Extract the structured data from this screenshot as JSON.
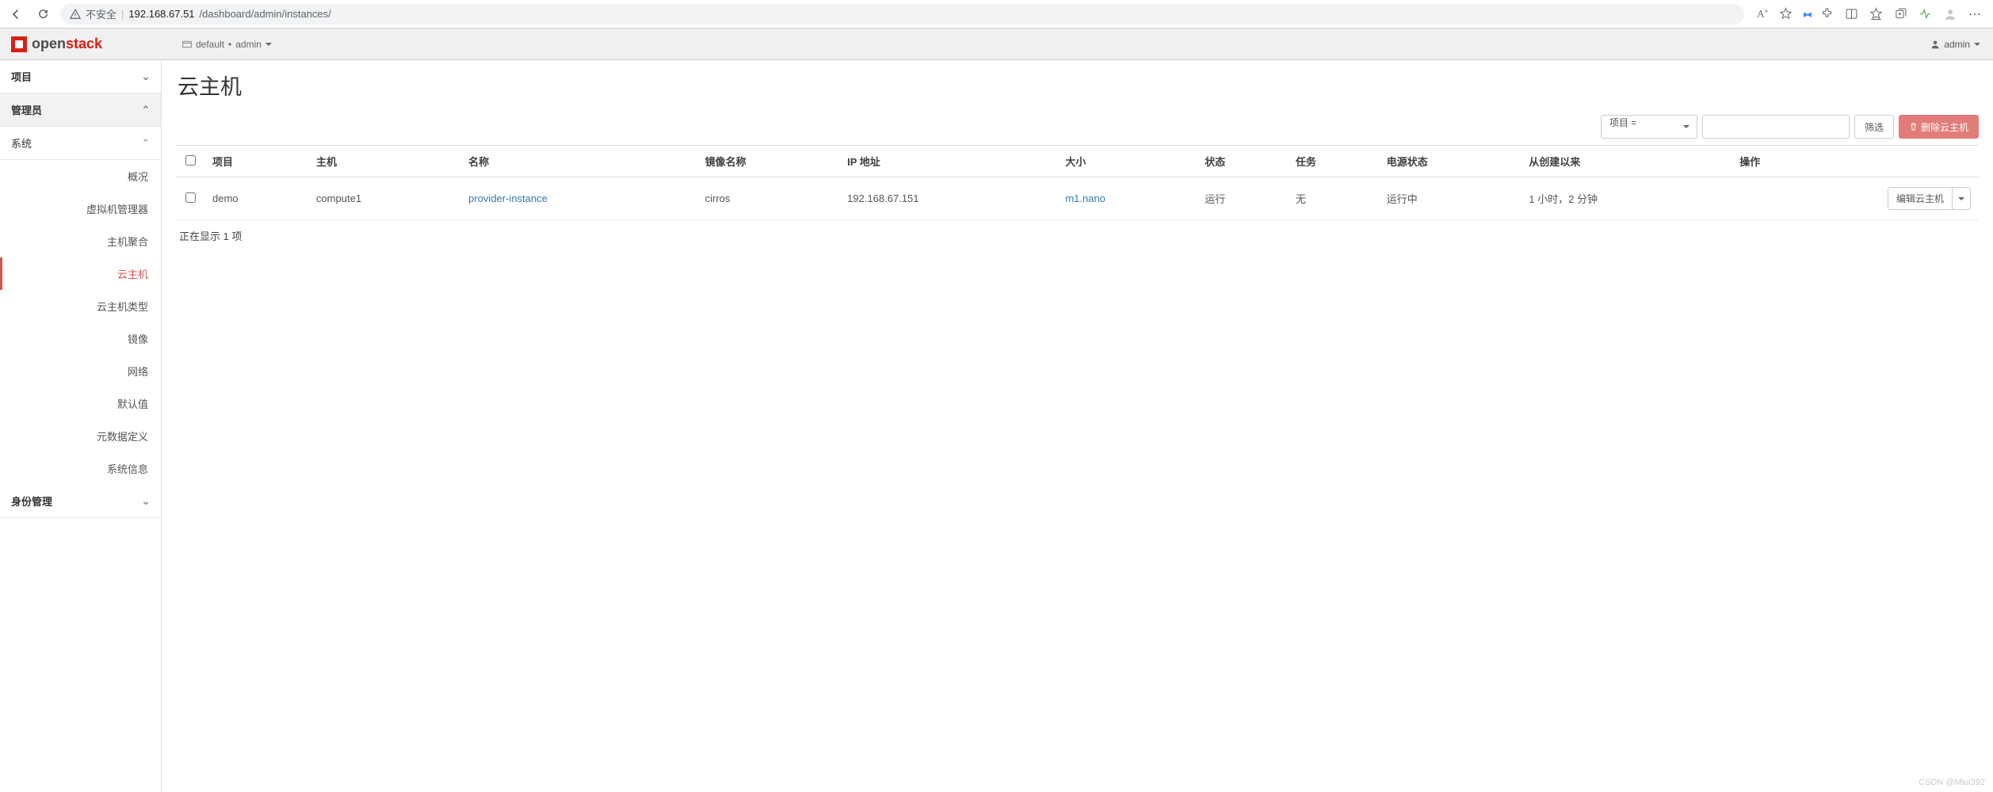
{
  "browser": {
    "security_label": "不安全",
    "url_host": "192.168.67.51",
    "url_path": "/dashboard/admin/instances/",
    "font_size_badge": "A"
  },
  "header": {
    "brand": "openstack",
    "context_domain": "default",
    "context_project": "admin",
    "user": "admin"
  },
  "sidebar": {
    "groups": [
      {
        "label": "项目",
        "open": false
      },
      {
        "label": "管理员",
        "open": true
      },
      {
        "label": "系统",
        "open": true,
        "sub": true
      },
      {
        "label": "身份管理",
        "open": false
      }
    ],
    "system_items": [
      {
        "label": "概况"
      },
      {
        "label": "虚拟机管理器"
      },
      {
        "label": "主机聚合"
      },
      {
        "label": "云主机",
        "active": true
      },
      {
        "label": "云主机类型"
      },
      {
        "label": "镜像"
      },
      {
        "label": "网络"
      },
      {
        "label": "默认值"
      },
      {
        "label": "元数据定义"
      },
      {
        "label": "系统信息"
      }
    ]
  },
  "page": {
    "title": "云主机",
    "filter_select": "项目 =",
    "filter_button": "筛选",
    "delete_button": "删除云主机",
    "footer": "正在显示 1 项"
  },
  "table": {
    "columns": [
      "项目",
      "主机",
      "名称",
      "镜像名称",
      "IP 地址",
      "大小",
      "状态",
      "任务",
      "电源状态",
      "从创建以来",
      "操作"
    ],
    "rows": [
      {
        "project": "demo",
        "host": "compute1",
        "name": "provider-instance",
        "image": "cirros",
        "ip": "192.168.67.151",
        "size": "m1.nano",
        "status": "运行",
        "task": "无",
        "power": "运行中",
        "since": "1 小时，2 分钟",
        "action": "编辑云主机"
      }
    ]
  },
  "watermark": "CSDN @Miui392"
}
